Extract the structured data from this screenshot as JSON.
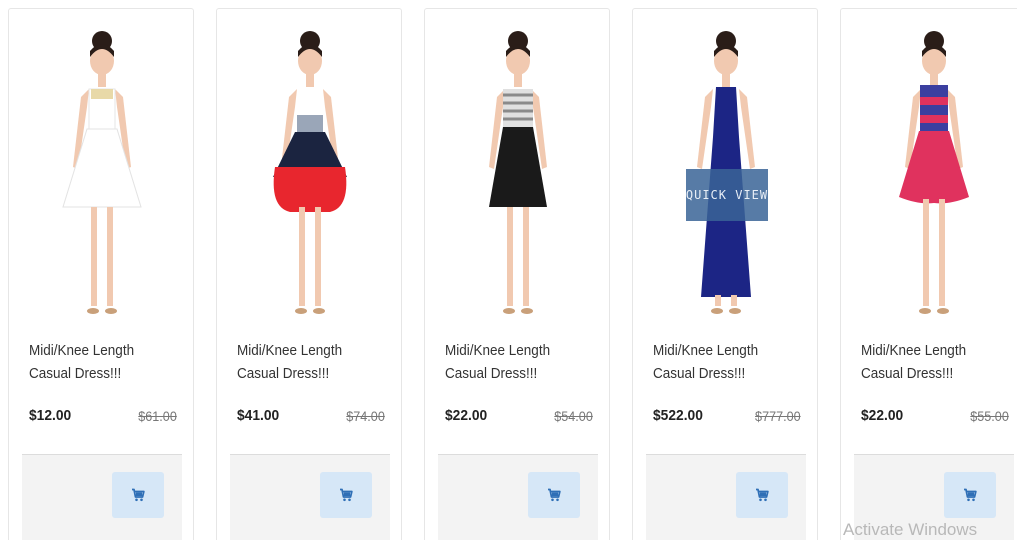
{
  "products": [
    {
      "title": "Midi/Knee Length Casual Dress!!!",
      "price": "$12.00",
      "old_price": "$61.00",
      "dress": "#ffffff",
      "accent": "#e8d9a8"
    },
    {
      "title": "Midi/Knee Length Casual Dress!!!",
      "price": "$41.00",
      "old_price": "$74.00",
      "dress": "#e8262e",
      "accent": "#1b2440"
    },
    {
      "title": "Midi/Knee Length Casual Dress!!!",
      "price": "$22.00",
      "old_price": "$54.00",
      "dress": "#1a1a1a",
      "accent": "#8a8a8a"
    },
    {
      "title": "Midi/Knee Length Casual Dress!!!",
      "price": "$522.00",
      "old_price": "$777.00",
      "dress": "#1c2585",
      "accent": "#1c2585"
    },
    {
      "title": "Midi/Knee Length Casual Dress!!!",
      "price": "$22.00",
      "old_price": "$55.00",
      "dress": "#e0325e",
      "accent": "#3b3fa0"
    }
  ],
  "quick_view_label": "QUICK VIEW",
  "cart_icon": "cart-icon",
  "cart_button_color": "#d6e7f7",
  "cart_icon_color": "#2f6fb6",
  "watermark": "Activate Windows"
}
